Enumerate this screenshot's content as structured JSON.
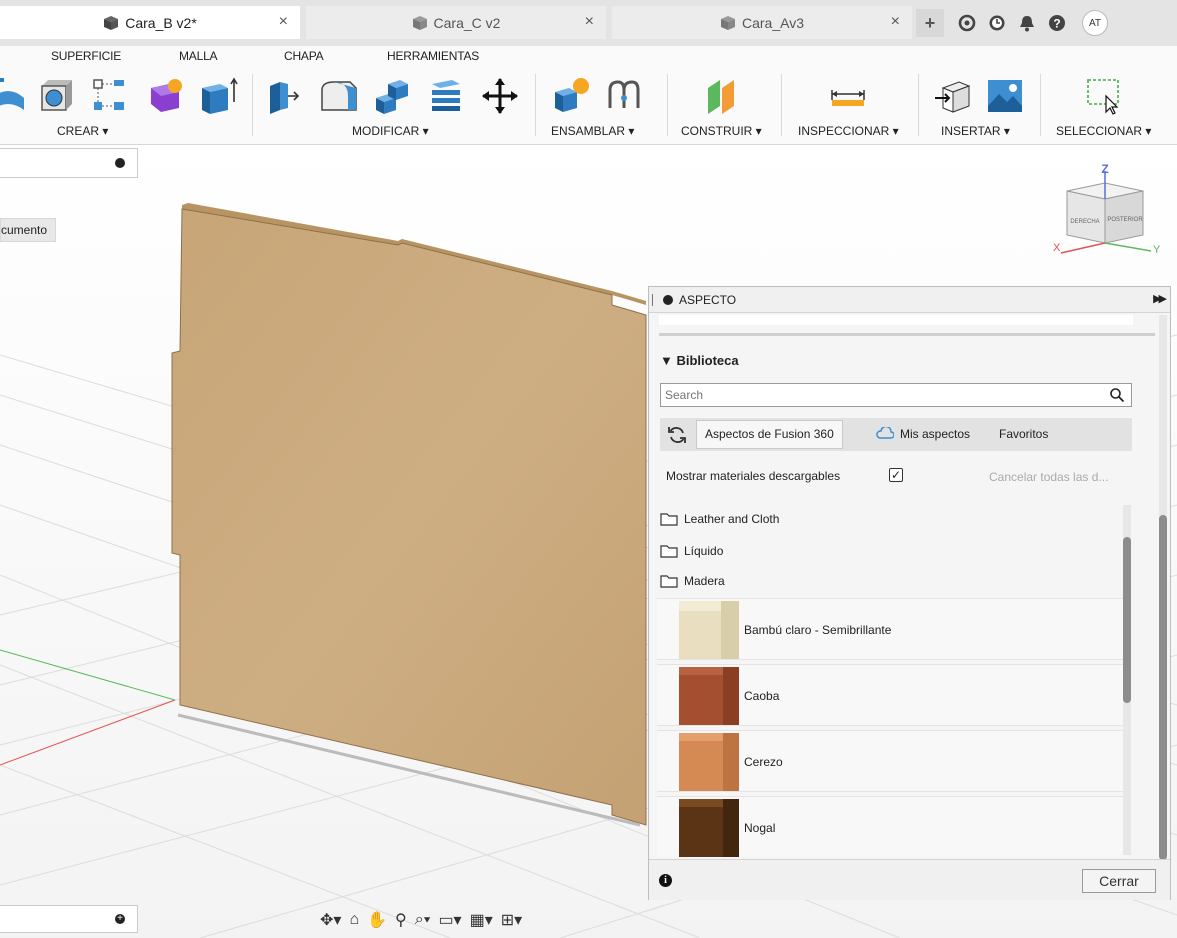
{
  "tabs": [
    {
      "label": "Cara_B v2*",
      "active": true
    },
    {
      "label": "Cara_C v2",
      "active": false
    },
    {
      "label": "Cara_Av3",
      "active": false
    }
  ],
  "tab_close_glyph": "×",
  "top_right": {
    "add": "+",
    "avatar": "AT"
  },
  "menu": [
    "SUPERFICIE",
    "MALLA",
    "CHAPA",
    "HERRAMIENTAS"
  ],
  "ribbon_groups": [
    "CREAR ▾",
    "MODIFICAR ▾",
    "ENSAMBLAR ▾",
    "CONSTRUIR ▾",
    "INSPECCIONAR ▾",
    "INSERTAR ▾",
    "SELECCIONAR ▾"
  ],
  "browser": {
    "doc_chip": "cumento"
  },
  "viewcube": {
    "front": "DERECHA",
    "right": "POSTERIOR",
    "z": "Z",
    "x": "X",
    "y": "Y"
  },
  "panel": {
    "title": "ASPECTO",
    "library_header": "▼ Biblioteca",
    "search_placeholder": "Search",
    "tabs": [
      "Aspectos de Fusion 360",
      "Mis aspectos",
      "Favoritos"
    ],
    "show_downloadable": "Mostrar materiales descargables",
    "show_downloadable_checked": "✓",
    "cancel_all": "Cancelar todas las d...",
    "folders": [
      "Leather and Cloth",
      "Líquido",
      "Madera"
    ],
    "materials": [
      {
        "name": "Bambú claro - Semibrillante",
        "color": "#e9dfc0"
      },
      {
        "name": "Caoba",
        "color": "#a34f30"
      },
      {
        "name": "Cerezo",
        "color": "#d48a52"
      },
      {
        "name": "Nogal",
        "color": "#5a3414"
      }
    ],
    "close_label": "Cerrar"
  },
  "colors": {
    "wood_panel": "#c8a77b",
    "accent_red": "#e45252",
    "accent_green": "#5cb85c"
  }
}
